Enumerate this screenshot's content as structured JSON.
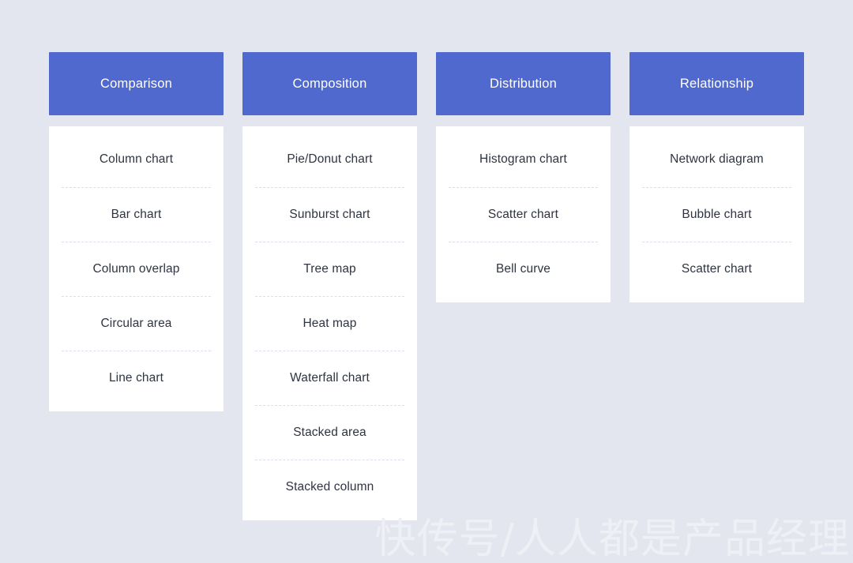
{
  "page": {
    "background_color": "#e3e6ef",
    "header_color": "#5069cf",
    "card_color": "#ffffff",
    "text_color": "#2e3440",
    "divider_color": "#dadfeb"
  },
  "columns": [
    {
      "title": "Comparison",
      "items": [
        {
          "label": "Column chart"
        },
        {
          "label": "Bar chart"
        },
        {
          "label": "Column overlap"
        },
        {
          "label": "Circular area"
        },
        {
          "label": "Line chart"
        }
      ]
    },
    {
      "title": "Composition",
      "items": [
        {
          "label": "Pie/Donut chart"
        },
        {
          "label": "Sunburst chart"
        },
        {
          "label": "Tree map"
        },
        {
          "label": "Heat map"
        },
        {
          "label": "Waterfall chart"
        },
        {
          "label": "Stacked area"
        },
        {
          "label": "Stacked column"
        }
      ]
    },
    {
      "title": "Distribution",
      "items": [
        {
          "label": "Histogram chart"
        },
        {
          "label": "Scatter chart"
        },
        {
          "label": "Bell curve"
        }
      ]
    },
    {
      "title": "Relationship",
      "items": [
        {
          "label": "Network diagram"
        },
        {
          "label": "Bubble chart"
        },
        {
          "label": "Scatter chart"
        }
      ]
    }
  ],
  "watermark": {
    "text": "快传号/人人都是产品经理"
  }
}
